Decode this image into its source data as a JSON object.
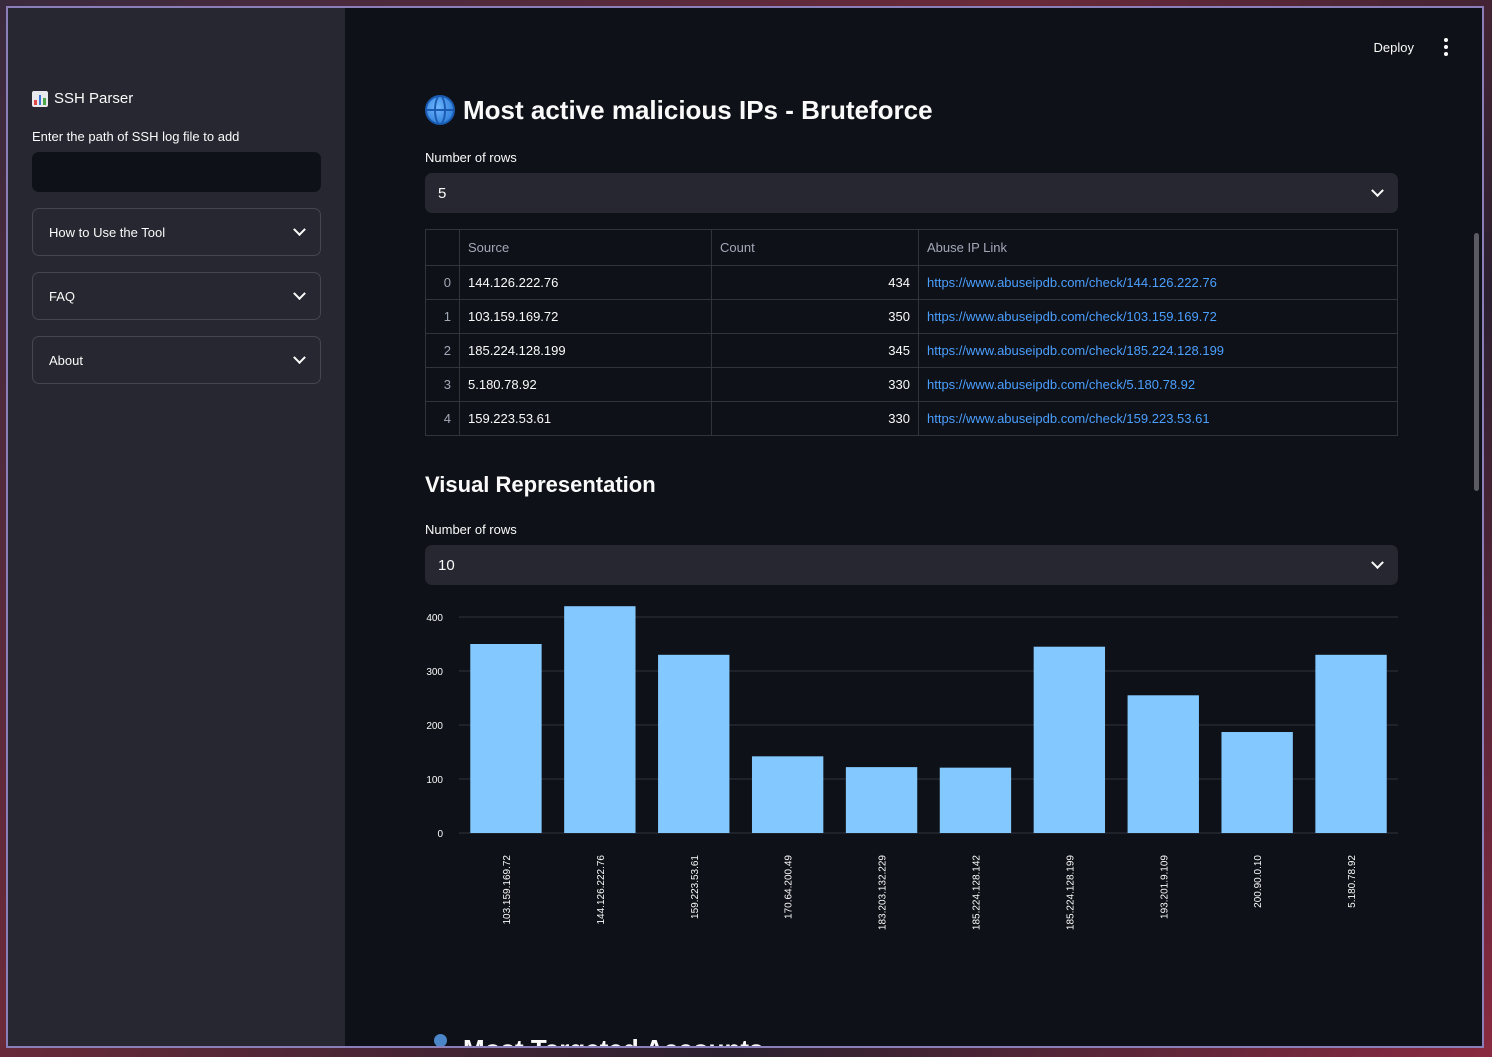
{
  "sidebar": {
    "app_title": "SSH Parser",
    "input_label": "Enter the path of SSH log file to add",
    "input_value": "",
    "expanders": [
      "How to Use the Tool",
      "FAQ",
      "About"
    ]
  },
  "topbar": {
    "deploy_label": "Deploy"
  },
  "section1": {
    "title": "Most active malicious IPs - Bruteforce",
    "rows_label": "Number of rows",
    "rows_value": "5",
    "table": {
      "columns": [
        "Source",
        "Count",
        "Abuse IP Link"
      ],
      "rows": [
        {
          "index": "0",
          "source": "144.126.222.76",
          "count": "434",
          "link": "https://www.abuseipdb.com/check/144.126.222.76"
        },
        {
          "index": "1",
          "source": "103.159.169.72",
          "count": "350",
          "link": "https://www.abuseipdb.com/check/103.159.169.72"
        },
        {
          "index": "2",
          "source": "185.224.128.199",
          "count": "345",
          "link": "https://www.abuseipdb.com/check/185.224.128.199"
        },
        {
          "index": "3",
          "source": "5.180.78.92",
          "count": "330",
          "link": "https://www.abuseipdb.com/check/5.180.78.92"
        },
        {
          "index": "4",
          "source": "159.223.53.61",
          "count": "330",
          "link": "https://www.abuseipdb.com/check/159.223.53.61"
        }
      ]
    }
  },
  "section2": {
    "title": "Visual Representation",
    "rows_label": "Number of rows",
    "rows_value": "10"
  },
  "chart_data": {
    "type": "bar",
    "categories": [
      "103.159.169.72",
      "144.126.222.76",
      "159.223.53.61",
      "170.64.200.49",
      "183.203.132.229",
      "185.224.128.142",
      "185.224.128.199",
      "193.201.9.109",
      "200.90.0.10",
      "5.180.78.92"
    ],
    "values": [
      350,
      420,
      330,
      142,
      122,
      121,
      345,
      255,
      187,
      330
    ],
    "ylim": [
      0,
      400
    ],
    "yticks": [
      "0",
      "100",
      "200",
      "300",
      "400"
    ],
    "grid": true,
    "bar_color": "#83c9ff"
  },
  "section3": {
    "title": "Most Targeted Accounts"
  }
}
